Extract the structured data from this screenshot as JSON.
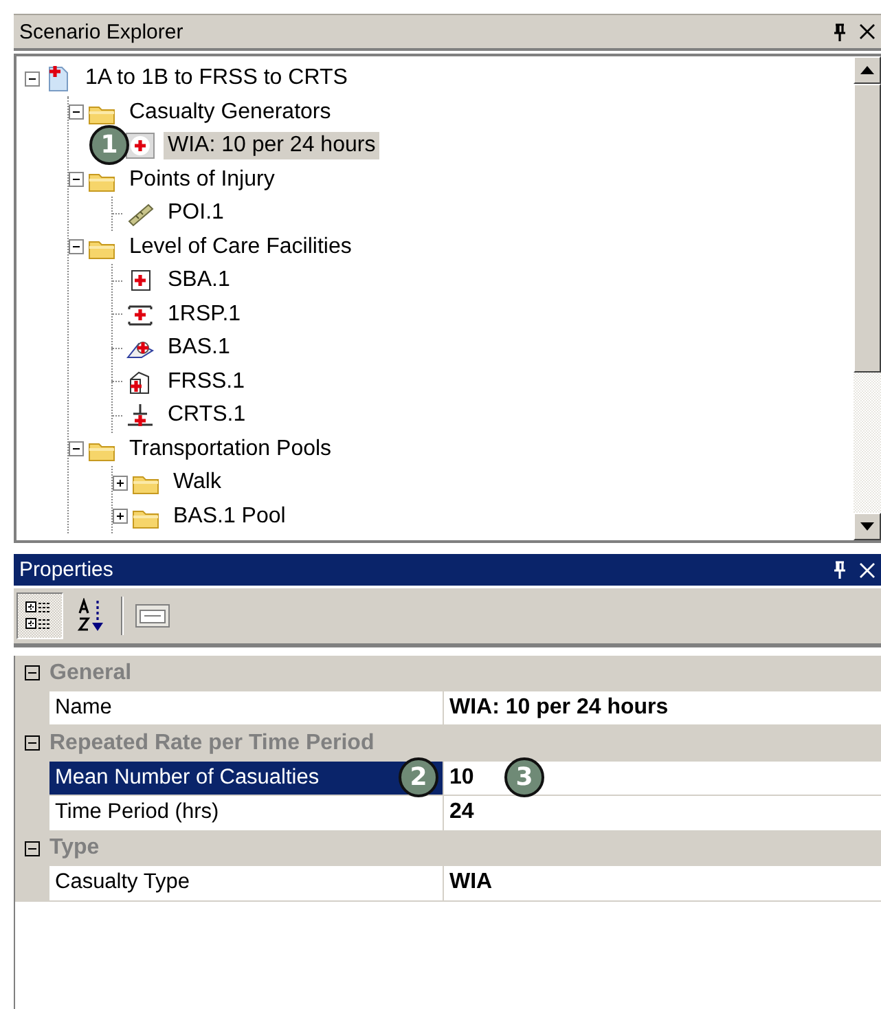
{
  "scenario_explorer": {
    "title": "Scenario Explorer",
    "tree": [
      {
        "label": "1A to 1B to FRSS to CRTS",
        "kind": "scenario",
        "expanded": true,
        "selected": false,
        "children": [
          {
            "label": "Casualty Generators",
            "kind": "folder",
            "expanded": true,
            "selected": false,
            "children": [
              {
                "label": "WIA: 10 per 24 hours",
                "kind": "casualty",
                "selected": true
              }
            ]
          },
          {
            "label": "Points of Injury",
            "kind": "folder",
            "expanded": true,
            "selected": false,
            "children": [
              {
                "label": "POI.1",
                "kind": "poi",
                "selected": false
              }
            ]
          },
          {
            "label": "Level of Care Facilities",
            "kind": "folder",
            "expanded": true,
            "selected": false,
            "children": [
              {
                "label": "SBA.1",
                "kind": "sba",
                "selected": false
              },
              {
                "label": "1RSP.1",
                "kind": "rsp",
                "selected": false
              },
              {
                "label": "BAS.1",
                "kind": "bas",
                "selected": false
              },
              {
                "label": "FRSS.1",
                "kind": "frss",
                "selected": false
              },
              {
                "label": "CRTS.1",
                "kind": "crts",
                "selected": false
              }
            ]
          },
          {
            "label": "Transportation Pools",
            "kind": "folder",
            "expanded": true,
            "selected": false,
            "children": [
              {
                "label": "Walk",
                "kind": "folder",
                "expanded": false,
                "selected": false
              },
              {
                "label": "BAS.1 Pool",
                "kind": "folder",
                "expanded": false,
                "selected": false
              }
            ]
          }
        ]
      }
    ]
  },
  "properties": {
    "title": "Properties",
    "toolbar": [
      {
        "kind": "categorized",
        "pressed": true
      },
      {
        "kind": "alphabetical",
        "pressed": false
      },
      {
        "kind": "property_pages",
        "pressed": false
      }
    ],
    "categories": [
      {
        "name": "General",
        "expanded": true,
        "rows": [
          {
            "name": "Name",
            "value": "WIA: 10 per 24 hours",
            "selected": false
          }
        ]
      },
      {
        "name": "Repeated Rate per Time Period",
        "expanded": true,
        "rows": [
          {
            "name": "Mean Number of Casualties",
            "value": "10",
            "selected": true
          },
          {
            "name": "Time Period (hrs)",
            "value": "24",
            "selected": false
          }
        ]
      },
      {
        "name": "Type",
        "expanded": true,
        "rows": [
          {
            "name": "Casualty Type",
            "value": "WIA",
            "selected": false
          }
        ]
      }
    ]
  },
  "callouts": [
    "1",
    "2",
    "3"
  ]
}
